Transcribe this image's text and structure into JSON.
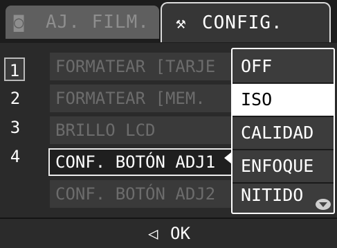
{
  "tabs": {
    "film": {
      "label": "AJ. FILM.",
      "icon": "camera-icon"
    },
    "config": {
      "label": "CONFIG.",
      "icon": "tools-icon"
    }
  },
  "list": {
    "numbers": [
      "1",
      "2",
      "3",
      "4"
    ],
    "items": [
      "FORMATEAR [TARJE",
      "FORMATEAR [MEM.",
      "BRILLO LCD",
      "CONF. BOTÓN ADJ1",
      "CONF. BOTÓN ADJ2"
    ]
  },
  "dropdown": {
    "options": [
      "OFF",
      "ISO",
      "CALIDAD",
      "ENFOQUE",
      "NITIDO"
    ],
    "selected": "ISO"
  },
  "footer": {
    "back_glyph": "◁",
    "ok_label": "OK"
  }
}
